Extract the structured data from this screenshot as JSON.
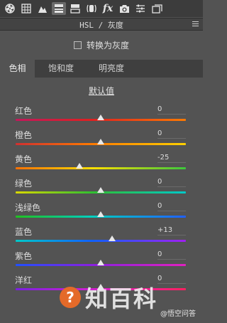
{
  "toolbar": {
    "icons": [
      "aperture-icon",
      "grid-icon",
      "mountain-icon",
      "hsl-panel-icon",
      "split-toning-icon",
      "lens-icon",
      "fx-icon",
      "camera-icon",
      "presets-icon",
      "snapshots-icon"
    ],
    "fx_label": "fx"
  },
  "panel": {
    "title": "HSL / 灰度"
  },
  "grayscale": {
    "label": "转换为灰度",
    "checked": false
  },
  "tabs": [
    {
      "label": "色相",
      "active": true
    },
    {
      "label": "饱和度",
      "active": false
    },
    {
      "label": "明亮度",
      "active": false
    }
  ],
  "default_link": "默认值",
  "sliders": [
    {
      "label": "红色",
      "value": "0",
      "value_num": 0
    },
    {
      "label": "橙色",
      "value": "0",
      "value_num": 0
    },
    {
      "label": "黄色",
      "value": "-25",
      "value_num": -25
    },
    {
      "label": "绿色",
      "value": "0",
      "value_num": 0
    },
    {
      "label": "浅绿色",
      "value": "0",
      "value_num": 0
    },
    {
      "label": "蓝色",
      "value": "+13",
      "value_num": 13
    },
    {
      "label": "紫色",
      "value": "0",
      "value_num": 0
    },
    {
      "label": "洋红",
      "value": "0",
      "value_num": 0
    }
  ],
  "colors": {
    "panel_bg": "#535353",
    "toolbar_bg": "#3c3c3c",
    "accent_watermark": "#e46a29"
  },
  "watermark": {
    "logo_glyph": "?",
    "brand": "知百科",
    "sub": "@悟空问答"
  }
}
